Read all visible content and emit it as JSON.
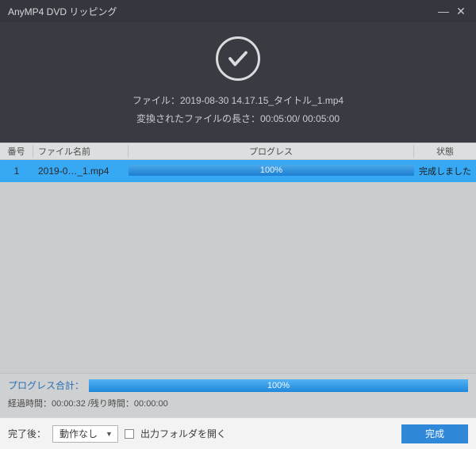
{
  "titlebar": {
    "title": "AnyMP4 DVD リッピング"
  },
  "hero": {
    "file_label": "ファイル：",
    "file_name": "2019-08-30 14.17.15_タイトル_1.mp4",
    "length_label": "変換されたファイルの長さ：",
    "length_value": "00:05:00/ 00:05:00"
  },
  "columns": {
    "num": "番号",
    "name": "ファイル名前",
    "progress": "プログレス",
    "status": "状態"
  },
  "rows": [
    {
      "num": "1",
      "name": "2019-0…_1.mp4",
      "percent": "100%",
      "status": "完成しました"
    }
  ],
  "total": {
    "label": "プログレス合計：",
    "percent": "100%",
    "time_line": "経過時間：00:00:32 /残り時間：00:00:00"
  },
  "footer": {
    "after_label": "完了後：",
    "after_value": "動作なし",
    "open_folder": "出力フォルダを開く",
    "done": "完成"
  }
}
